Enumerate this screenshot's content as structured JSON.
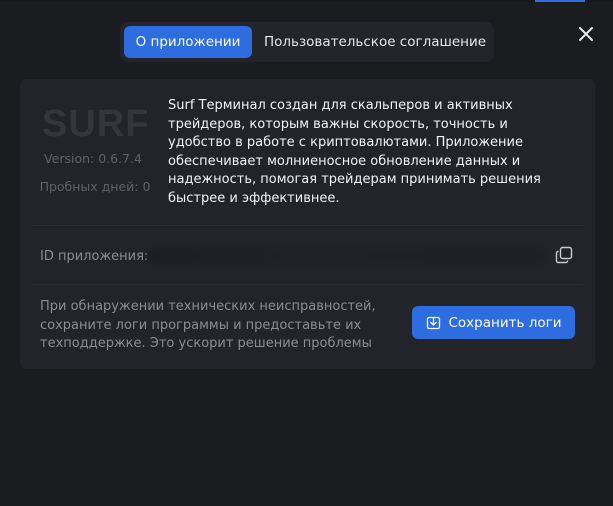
{
  "tabs": [
    {
      "label": "О приложении",
      "active": true
    },
    {
      "label": "Пользовательское соглашение",
      "active": false
    }
  ],
  "about": {
    "logo_text": "SURF",
    "version": "Version: 0.6.7.4",
    "trial_days": "Пробных дней: 0",
    "description": "Surf Терминал создан для скальперов и активных трейдеров, которым важны скорость, точность и удобство в работе с криптовалютами. Приложение обеспечивает молниеносное обновление данных и надежность, помогая трейдерам принимать решения быстрее и эффективнее."
  },
  "app_id": {
    "label": "ID приложения:"
  },
  "logs": {
    "text": "При обнаружении технических неисправностей, сохраните логи программы и предоставьте их техподдержке. Это ускорит решение проблемы",
    "button_label": "Сохранить логи"
  },
  "icons": {
    "close": "close-icon",
    "copy": "copy-icon",
    "save": "download-icon"
  },
  "colors": {
    "accent": "#2d6de0",
    "background": "#1b1c20",
    "card": "#232429"
  }
}
